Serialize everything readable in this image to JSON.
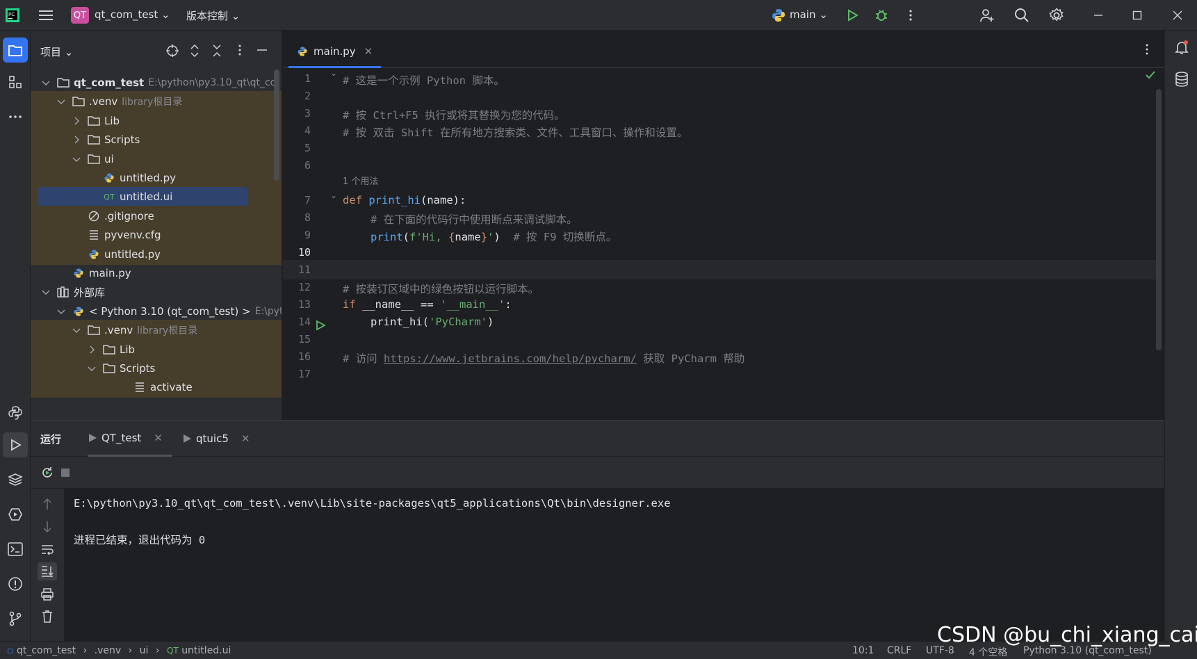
{
  "titlebar": {
    "project_badge": "QT",
    "project_name": "qt_com_test",
    "vcs_label": "版本控制",
    "run_config": "main",
    "icons": [
      "pycharm-logo-icon",
      "hamburger-menu-icon",
      "python-icon",
      "run-icon",
      "debug-icon",
      "more-icon",
      "add-user-icon",
      "search-icon",
      "settings-icon",
      "minimize-icon",
      "maximize-icon",
      "close-icon"
    ]
  },
  "left_strip": {
    "icons": [
      "project-folder-icon",
      "structure-icon",
      "more-tools-icon",
      "python-console-icon",
      "run-tool-icon",
      "services-icon",
      "python-packages-icon",
      "terminal-icon",
      "problems-icon",
      "git-icon"
    ]
  },
  "right_strip": {
    "icons": [
      "notifications-icon",
      "database-icon"
    ]
  },
  "project_panel": {
    "title": "项目",
    "rows": [
      {
        "name": "qt_com_test",
        "hint": "E:\\python\\py3.10_qt\\qt_co",
        "depth": 0,
        "chev": "down",
        "icon": "folder",
        "bold": true
      },
      {
        "name": ".venv",
        "hint": "library根目录",
        "depth": 1,
        "chev": "down",
        "icon": "folder"
      },
      {
        "name": "Lib",
        "hint": "",
        "depth": 2,
        "chev": "right",
        "icon": "folder"
      },
      {
        "name": "Scripts",
        "hint": "",
        "depth": 2,
        "chev": "right",
        "icon": "folder"
      },
      {
        "name": "ui",
        "hint": "",
        "depth": 2,
        "chev": "down",
        "icon": "folder"
      },
      {
        "name": "untitled.py",
        "hint": "",
        "depth": 3,
        "chev": "",
        "icon": "python"
      },
      {
        "name": "untitled.ui",
        "hint": "",
        "depth": 3,
        "chev": "",
        "icon": "qt",
        "selected": true
      },
      {
        "name": ".gitignore",
        "hint": "",
        "depth": 2,
        "chev": "",
        "icon": "ignore"
      },
      {
        "name": "pyvenv.cfg",
        "hint": "",
        "depth": 2,
        "chev": "",
        "icon": "text"
      },
      {
        "name": "untitled.py",
        "hint": "",
        "depth": 2,
        "chev": "",
        "icon": "python"
      },
      {
        "name": "main.py",
        "hint": "",
        "depth": 1,
        "chev": "",
        "icon": "python"
      },
      {
        "name": "外部库",
        "hint": "",
        "depth": 0,
        "chev": "down",
        "icon": "library"
      },
      {
        "name": "< Python 3.10 (qt_com_test) >",
        "hint": "E:\\pyth",
        "depth": 1,
        "chev": "down",
        "icon": "python"
      },
      {
        "name": ".venv",
        "hint": "library根目录",
        "depth": 2,
        "chev": "down",
        "icon": "folder"
      },
      {
        "name": "Lib",
        "hint": "",
        "depth": 3,
        "chev": "right",
        "icon": "folder"
      },
      {
        "name": "Scripts",
        "hint": "",
        "depth": 3,
        "chev": "down",
        "icon": "folder"
      },
      {
        "name": "activate",
        "hint": "",
        "depth": 5,
        "chev": "",
        "icon": "text"
      }
    ]
  },
  "editor": {
    "tab_label": "main.py",
    "usage_hint": "1 个用法",
    "line_numbers": [
      "1",
      "2",
      "3",
      "4",
      "5",
      "6",
      "7",
      "8",
      "9",
      "10",
      "11",
      "12",
      "13",
      "14",
      "15",
      "16",
      "17"
    ],
    "lines": {
      "l1": "# 这是一个示例 Python 脚本。",
      "l3": "# 按 Ctrl+F5 执行或将其替换为您的代码。",
      "l4": "# 按 双击 Shift 在所有地方搜索类、文件、工具窗口、操作和设置。",
      "l7_kw": "def",
      "l7_fn": "print_hi",
      "l7_rest": "(name):",
      "l8": "# 在下面的代码行中使用断点来调试脚本。",
      "l9_fn": "print",
      "l9_a": "(",
      "l9_str1": "f'Hi, ",
      "l9_brace1": "{",
      "l9_var": "name",
      "l9_brace2": "}",
      "l9_str2": "'",
      "l9_b": ")  ",
      "l9_cm": "# 按 F9 切换断点。",
      "l12": "# 按装订区域中的绿色按钮以运行脚本。",
      "l13_kw": "if",
      "l13_mid": " __name__ == ",
      "l13_str": "'__main__'",
      "l13_end": ":",
      "l14_a": "print_hi(",
      "l14_str": "'PyCharm'",
      "l14_b": ")",
      "l16_a": "# 访问 ",
      "l16_link": "https://www.jetbrains.com/help/pycharm/",
      "l16_b": " 获取 PyCharm 帮助"
    }
  },
  "run_panel": {
    "title": "运行",
    "tabs": [
      "QT_test",
      "qtuic5"
    ],
    "output": [
      "E:\\python\\py3.10_qt\\qt_com_test\\.venv\\Lib\\site-packages\\qt5_applications\\Qt\\bin\\designer.exe",
      "",
      "进程已结束，退出代码为 0"
    ]
  },
  "status_bar": {
    "breadcrumb": [
      "qt_com_test",
      ".venv",
      "ui",
      "untitled.ui"
    ],
    "position": "10:1",
    "line_sep": "CRLF",
    "encoding": "UTF-8",
    "indent": "4 个空格",
    "interpreter": "Python 3.10 (qt_com_test)"
  },
  "watermark": "CSDN @bu_chi_xiang_cai",
  "colors": {
    "accent": "#3574f0",
    "venv_highlight": "#463d2b",
    "selection": "#2e436e",
    "run_green": "#5fb865"
  }
}
